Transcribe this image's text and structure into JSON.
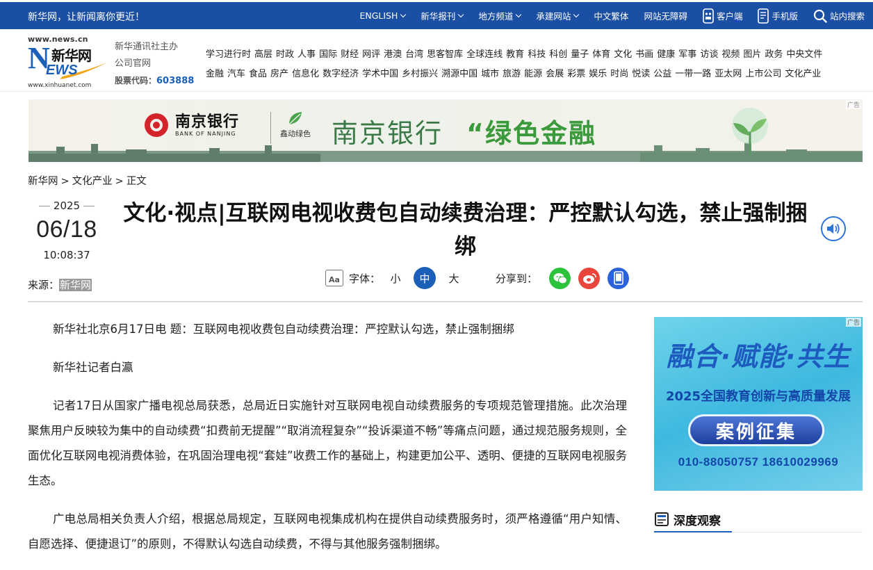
{
  "topbar": {
    "slogan": "新华网，让新闻离你更近！",
    "nav": [
      {
        "label": "ENGLISH",
        "dropdown": true
      },
      {
        "label": "新华报刊",
        "dropdown": true
      },
      {
        "label": "地方频道",
        "dropdown": true
      },
      {
        "label": "承建网站",
        "dropdown": true
      },
      {
        "label": "中文繁体",
        "dropdown": false
      },
      {
        "label": "网站无障碍",
        "dropdown": false
      },
      {
        "label": "客户端",
        "icon": "app-icon"
      },
      {
        "label": "手机版",
        "icon": "mobile-icon"
      },
      {
        "label": "站内搜索",
        "icon": "search-icon"
      }
    ]
  },
  "header": {
    "logo": {
      "url_top": "www.news.cn",
      "url_bottom": "www.xinhuanet.com",
      "brand_cn": "新华网",
      "brand_n": "N",
      "brand_ews": "EWS"
    },
    "owner_line1": "新华通讯社主办",
    "owner_line2": "公司官网",
    "stock_label": "股票代码：",
    "stock_code": "603888",
    "channels_row1": [
      "学习进行时",
      "高层",
      "时政",
      "人事",
      "国际",
      "财经",
      "网评",
      "港澳",
      "台湾",
      "思客智库",
      "全球连线",
      "教育",
      "科技",
      "科创",
      "量子",
      "体育",
      "文化",
      "书画",
      "健康",
      "军事",
      "访谈",
      "视频",
      "图片",
      "政务",
      "中央文件"
    ],
    "channels_row2": [
      "金融",
      "汽车",
      "食品",
      "房产",
      "信息化",
      "数字经济",
      "学术中国",
      "乡村振兴",
      "溯源中国",
      "城市",
      "旅游",
      "能源",
      "会展",
      "彩票",
      "娱乐",
      "时尚",
      "悦读",
      "公益",
      "一带一路",
      "亚太网",
      "上市公司",
      "文化产业"
    ]
  },
  "banner": {
    "ad_tag": "广告",
    "bank_name": "南京银行",
    "bank_en": "BANK OF NANJING",
    "sub_brand": "鑫动绿色",
    "slogan_a": "南京银行",
    "slogan_b": "“绿色金融"
  },
  "breadcrumb": [
    "新华网",
    "文化产业",
    "正文"
  ],
  "article": {
    "year": "2025",
    "month_day": "06/18",
    "time": "10:08:37",
    "source_label": "来源：",
    "source_name": "新华网",
    "title": "文化·视点|互联网电视收费包自动续费治理：严控默认勾选，禁止强制捆绑",
    "font_label": "字体：",
    "font_sizes": [
      "小",
      "中",
      "大"
    ],
    "font_size_selected": "中",
    "share_label": "分享到：",
    "paragraphs": [
      "新华社北京6月17日电 题：互联网电视收费包自动续费治理：严控默认勾选，禁止强制捆绑",
      "新华社记者白瀛",
      "记者17日从国家广播电视总局获悉，总局近日实施针对互联网电视自动续费服务的专项规范管理措施。此次治理聚焦用户反映较为集中的自动续费“扣费前无提醒”“取消流程复杂”“投诉渠道不畅”等痛点问题，通过规范服务规则，全面优化互联网电视消费体验，在巩固治理电视“套娃”收费工作的基础上，构建更加公平、透明、便捷的互联网电视服务生态。",
      "广电总局相关负责人介绍，根据总局规定，互联网电视集成机构在提供自动续费服务时，须严格遵循“用户知情、自愿选择、便捷退订”的原则，不得默认勾选自动续费，不得与其他服务强制捆绑。"
    ]
  },
  "side_ad": {
    "ad_tag": "广告",
    "calligraphy": "融合·赋能·共生",
    "headline": "2025全国教育创新与高质量发展",
    "pill": "案例征集",
    "phones": "010-88050757  18610029969"
  },
  "section": {
    "title": "深度观察"
  },
  "colors": {
    "brand_blue": "#1b4fa3",
    "accent_blue": "#1b5fb8",
    "wechat_green": "#2bc23c",
    "weibo_red": "#e8453c",
    "mobile_blue": "#2a63d9"
  }
}
